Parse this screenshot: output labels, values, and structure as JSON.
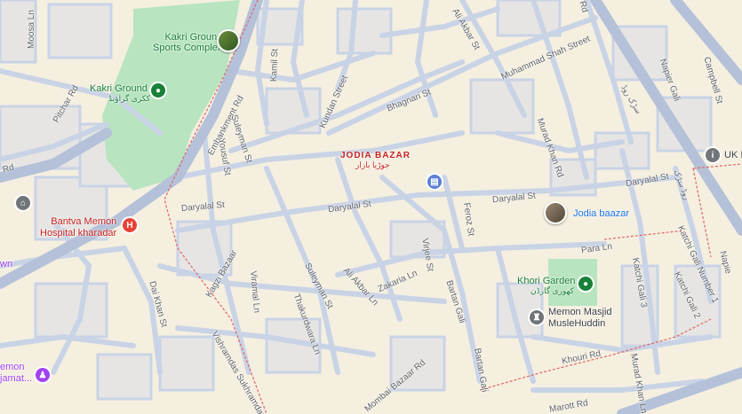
{
  "colors": {
    "land": "#f5efe0",
    "block": "#e8e6e1",
    "street": "#c9d3e6",
    "major_road": "#b4c1d9",
    "park": "#b8e4c0",
    "boundary": "#e06666"
  },
  "areas": {
    "jodia_bazar": "JODIA BAZAR",
    "jodia_bazar_urdu": "جوڑیا بازار"
  },
  "places": {
    "kakri_sports": "Kakri Ground\nSports Complex",
    "kakri_ground": "Kakri Ground",
    "kakri_ground_urdu": "ککری گراؤنڈ",
    "bantva_hospital": "Bantva Memon\nHospital kharadar",
    "jodia_baazar": "Jodia baazar",
    "khori_garden": "Khori Garden",
    "khori_garden_urdu": "کھوری گارڈن",
    "memon_masjid": "Memon Masjid\nMusleHuddin",
    "uk": "UK I",
    "memon_jamat": "emon\njamat...",
    "left_edge_wn": "wn"
  },
  "streets": {
    "moosa_ln": "Moosa Ln",
    "pitchar_rd": "Pitchar Rd",
    "embankment_rd": "Embankment Rd",
    "kamil_st": "Kamil St",
    "suleyman_st_n": "Suleyman St",
    "yousuf_st": "Yousuf St",
    "kundan_street": "Kundan Street",
    "bhagnari_st": "Bhagnari St",
    "ali_akbar_st": "Ali Akbar St",
    "muhammad_shah_street": "Muhammad Shah Street",
    "murad_khan_rd": "Murad Khan Rd",
    "napier_gali": "Napier Gali",
    "campbell_st": "Campbell St",
    "daryalal_st_w": "Daryalal St",
    "daryalal_st_c": "Daryalal St",
    "daryalal_st_e": "Daryalal St",
    "daryalal_st_ne": "Daryalal St",
    "feroz_st": "Feroz St",
    "para_ln": "Para Ln",
    "katchi_gali_1": "Katchi Gali Number 1",
    "katchi_gali_2": "Katchi Gali 2",
    "katchi_gali_3": "Katchi Gali 3",
    "kagzi_bazaar": "Kagzi Bazaar",
    "viramal_ln": "Viramal Ln",
    "suleyman_st_s": "Suleyman St",
    "thakurdwara_ln": "Thakurdwara Ln",
    "ali_akbar_ln": "Ali Akbar Ln",
    "zakaria_ln": "Zakaria Ln",
    "virjee_st": "Virjee St",
    "bartan_gali_n": "Bartan Gali",
    "bartan_gali_s": "Bartan Gali",
    "daikhan_st": "Dai Khan St",
    "vishramdas_rd": "Vishramdas Sukhramdas Rd",
    "mombai_bazaar_rd": "Mombai Bazaar Rd",
    "khouri_rd": "Khouri Rd",
    "murad_khan_ln": "Murad Khan Ln",
    "marott_rd": "Marott Rd",
    "r_rd": "Rd",
    "e_rd": "Rd",
    "urdu_rd_1": "سڑک روڈ",
    "urdu_rd_2": "روڈ سڑک",
    "napier_rd_right": "Napie"
  }
}
